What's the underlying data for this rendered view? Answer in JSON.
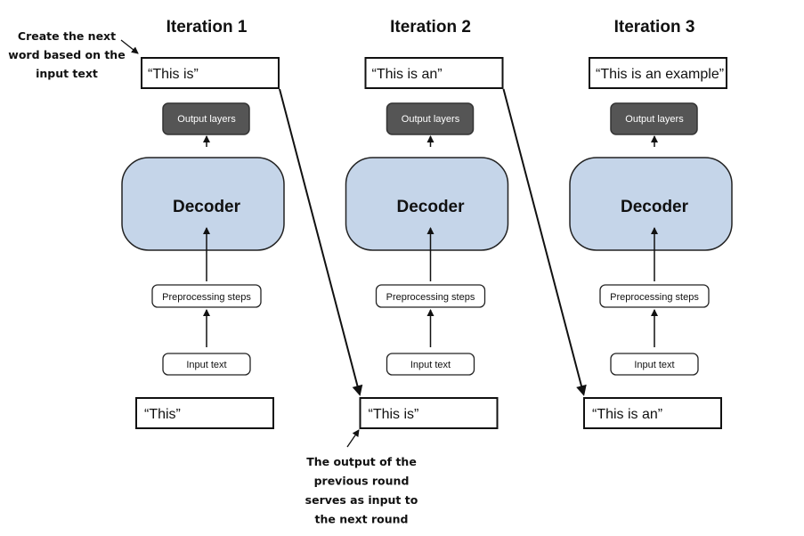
{
  "colors": {
    "decoder_fill": "#c5d5e9",
    "output_layers_fill": "#555555",
    "stroke": "#111111"
  },
  "iterations": [
    {
      "title": "Iteration 1",
      "output_text": "“This is”",
      "input_text": "“This”"
    },
    {
      "title": "Iteration 2",
      "output_text": "“This is an”",
      "input_text": "“This is”"
    },
    {
      "title": "Iteration 3",
      "output_text": "“This is an example”",
      "input_text": "“This is an”"
    }
  ],
  "blocks": {
    "output_layers": "Output layers",
    "decoder": "Decoder",
    "preprocessing": "Preprocessing steps",
    "input_text": "Input text"
  },
  "annotations": {
    "top_left": [
      "Create the next",
      "word based on the",
      "input text"
    ],
    "bottom": [
      "The output of the",
      "previous round",
      "serves as input to",
      "the next round"
    ]
  }
}
